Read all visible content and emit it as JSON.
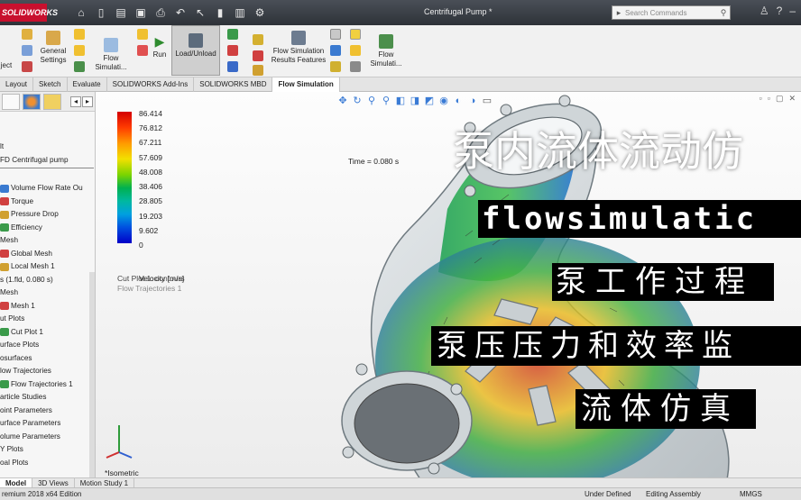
{
  "app": {
    "logo_text": "SOLIDWORKS",
    "document_title": "Centrifugal Pump *",
    "search_placeholder": "Search Commands"
  },
  "command_manager": {
    "buttons": [
      {
        "label": "General Settings"
      },
      {
        "label": "Flow Simulati..."
      },
      {
        "label": "Run"
      },
      {
        "label": "Load/Unload"
      },
      {
        "label": "Flow Simulation Results Features"
      },
      {
        "label": "Flow Simulati..."
      }
    ],
    "left_label": "ject"
  },
  "tabs": [
    {
      "label": "Layout"
    },
    {
      "label": "Sketch"
    },
    {
      "label": "Evaluate"
    },
    {
      "label": "SOLIDWORKS Add-Ins"
    },
    {
      "label": "SOLIDWORKS MBD"
    },
    {
      "label": "Flow Simulation",
      "active": true
    }
  ],
  "tree": {
    "header_items": [
      "lt",
      "FD Centrifugal pump"
    ],
    "items": [
      {
        "label": "Volume Flow Rate Ou",
        "indent": true
      },
      {
        "label": "Torque",
        "indent": true
      },
      {
        "label": "Pressure Drop",
        "indent": true
      },
      {
        "label": "Efficiency",
        "indent": true
      },
      {
        "label": "Mesh",
        "indent": false
      },
      {
        "label": "Global Mesh",
        "indent": true
      },
      {
        "label": "Local Mesh 1",
        "indent": true
      },
      {
        "label": "s (1.fld, 0.080 s)",
        "indent": false
      },
      {
        "label": "Mesh",
        "indent": false
      },
      {
        "label": "Mesh 1",
        "indent": true
      },
      {
        "label": "ut Plots",
        "indent": false
      },
      {
        "label": "Cut Plot 1",
        "indent": true
      },
      {
        "label": "urface Plots",
        "indent": false
      },
      {
        "label": "osurfaces",
        "indent": false
      },
      {
        "label": "low Trajectories",
        "indent": false
      },
      {
        "label": "Flow Trajectories 1",
        "indent": true
      },
      {
        "label": "article Studies",
        "indent": false
      },
      {
        "label": "oint Parameters",
        "indent": false
      },
      {
        "label": "urface Parameters",
        "indent": false
      },
      {
        "label": "olume Parameters",
        "indent": false
      },
      {
        "label": "Y Plots",
        "indent": false
      },
      {
        "label": "oal Plots",
        "indent": false
      }
    ]
  },
  "legend": {
    "values": [
      "86.414",
      "76.812",
      "67.211",
      "57.609",
      "48.008",
      "38.406",
      "28.805",
      "19.203",
      "9.602",
      "0"
    ],
    "unit_label": "Velocity [m/s]",
    "cut_plot_label": "Cut Plot 1: contours",
    "flow_traj_label": "Flow Trajectories 1"
  },
  "viewport": {
    "time_label": "Time = 0.080 s",
    "view_label": "*Isometric"
  },
  "overlay": {
    "title": "泵内流体流动仿",
    "line1": "flowsimulatic",
    "line2": "泵工作过程",
    "line3": "泵压压力和效率监",
    "line4": "流体仿真"
  },
  "bottom_tabs": [
    {
      "label": "Model",
      "active": true
    },
    {
      "label": "3D Views"
    },
    {
      "label": "Motion Study 1"
    }
  ],
  "status": {
    "edition": "remium 2018 x64 Edition",
    "defined": "Under Defined",
    "mode": "Editing Assembly",
    "units": "MMGS"
  },
  "colors": {
    "accent_red": "#c8102e",
    "legend_max": "#d40000",
    "legend_min": "#0000c8"
  }
}
